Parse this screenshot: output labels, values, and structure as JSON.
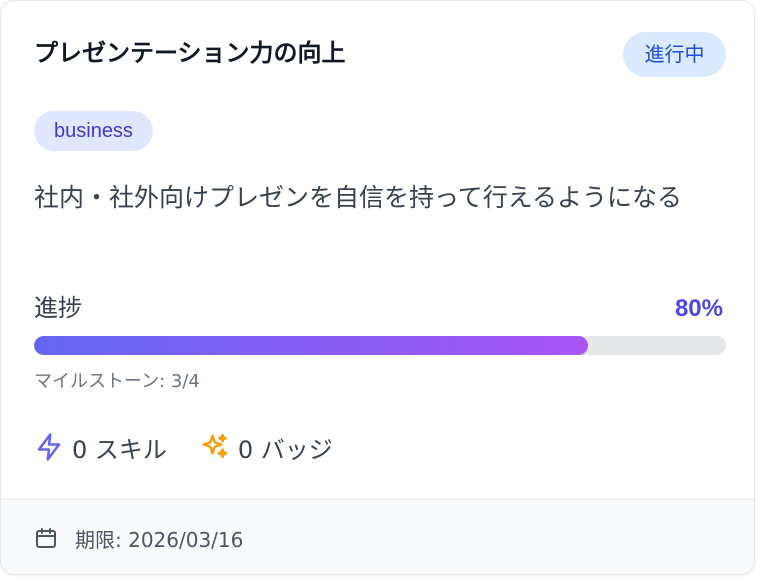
{
  "goal": {
    "title": "プレゼンテーション力の向上",
    "status": "進行中",
    "tag": "business",
    "description": "社内・社外向けプレゼンを自信を持って行えるようになる",
    "progress": {
      "label": "進捗",
      "value_text": "80%",
      "value": 80
    },
    "milestones": "マイルストーン: 3/4",
    "stats": {
      "skills": "0 スキル",
      "badges": "0 バッジ"
    },
    "deadline": "期限: 2026/03/16"
  },
  "icons": {
    "skills": "lightning-icon",
    "badges": "sparkles-icon",
    "deadline": "calendar-icon"
  },
  "colors": {
    "status_bg": "#dbeafe",
    "status_text": "#1d4ed8",
    "tag_bg": "#e0e7ff",
    "tag_text": "#4338ca",
    "progress_start": "#6366f1",
    "progress_end": "#a855f7",
    "skills_icon": "#6366f1",
    "badges_icon": "#f59e0b"
  }
}
